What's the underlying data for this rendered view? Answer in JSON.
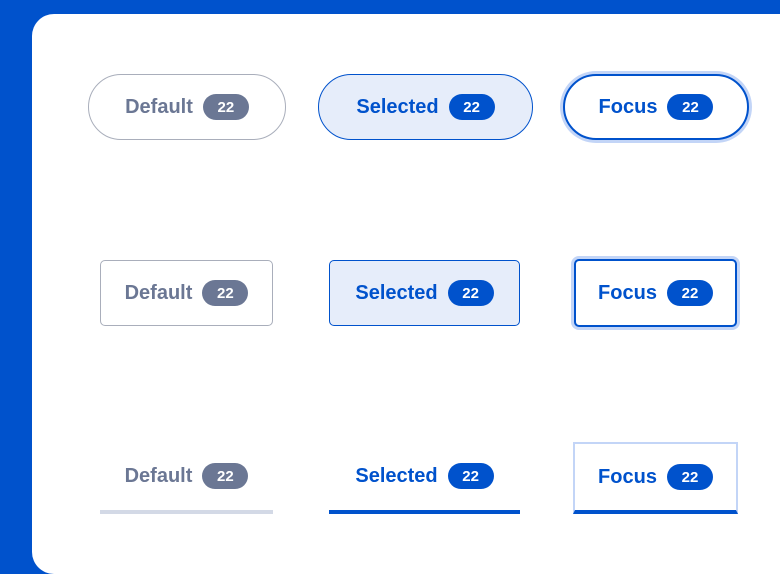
{
  "chips": {
    "default_label": "Default",
    "selected_label": "Selected",
    "focus_label": "Focus",
    "count": "22"
  },
  "colors": {
    "background": "#0052cc",
    "panel": "#ffffff",
    "primary": "#0052cc",
    "neutral": "#6b7794",
    "selected_fill": "#e6edfa",
    "focus_ring": "#c3d5f7",
    "default_border": "#a9aebb",
    "default_underline": "#d3d9e6"
  }
}
